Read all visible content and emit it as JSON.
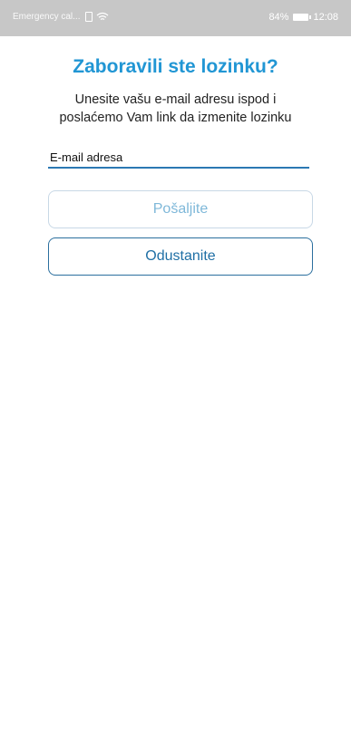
{
  "status_bar": {
    "carrier": "Emergency cal...",
    "battery_percent": "84%",
    "time": "12:08",
    "icons": [
      "sim-icon",
      "wifi-icon",
      "battery-icon"
    ]
  },
  "screen": {
    "title": "Zaboravili ste lozinku?",
    "subtitle_line1": "Unesite vašu e-mail adresu ispod i",
    "subtitle_line2": "poslaćemo Vam link da izmenite lozinku",
    "email_placeholder": "E-mail adresa",
    "send_button": "Pošaljite",
    "cancel_button": "Odustanite"
  },
  "colors": {
    "title": "#2196d4",
    "cancel_button_border": "#2b6f9e",
    "send_button_text_disabled": "#7fb8d9",
    "status_bar_bg": "#c7c7c7"
  }
}
